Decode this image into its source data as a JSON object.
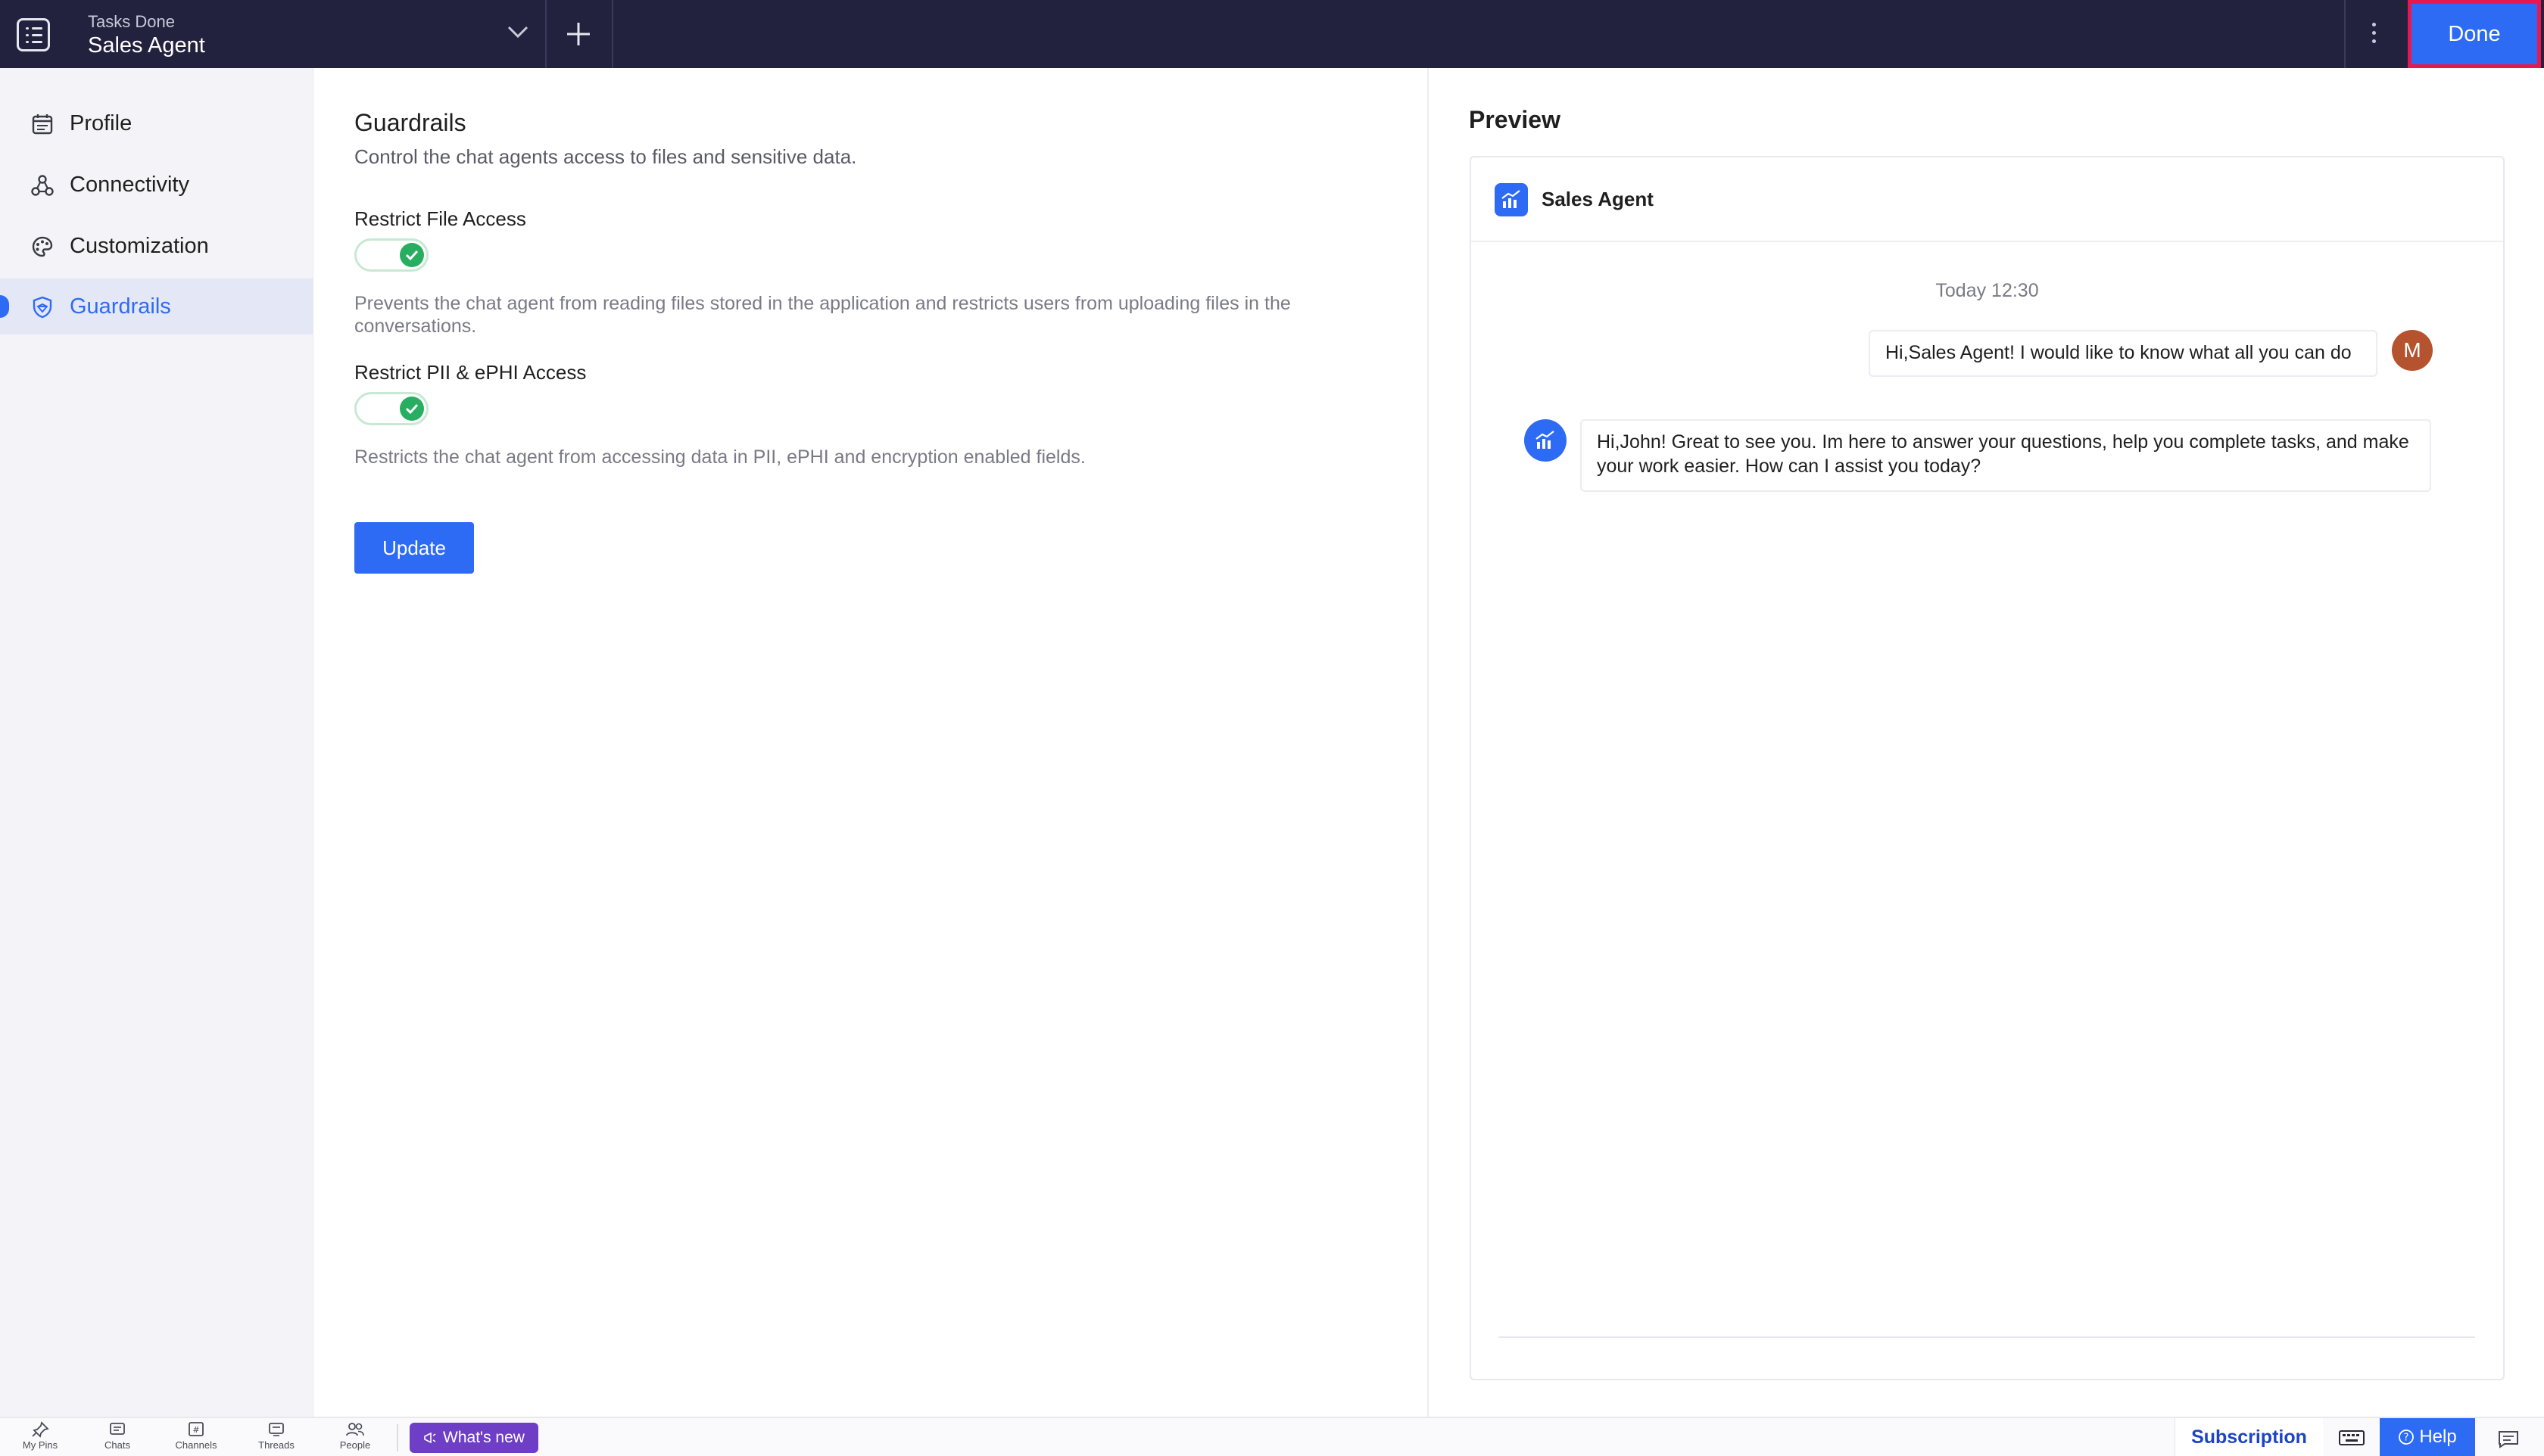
{
  "topbar": {
    "subtitle": "Tasks Done",
    "title": "Sales Agent",
    "done_label": "Done"
  },
  "sidebar": {
    "items": [
      {
        "label": "Profile",
        "icon": "calendar-icon"
      },
      {
        "label": "Connectivity",
        "icon": "network-icon"
      },
      {
        "label": "Customization",
        "icon": "palette-icon"
      },
      {
        "label": "Guardrails",
        "icon": "shield-icon",
        "active": true
      }
    ]
  },
  "guardrails": {
    "title": "Guardrails",
    "subtitle": "Control the chat agents access to files and sensitive data.",
    "options": [
      {
        "title": "Restrict File Access",
        "enabled": true,
        "description": "Prevents the chat agent from reading files stored in the application and restricts users from uploading files in the conversations."
      },
      {
        "title": "Restrict PII & ePHI Access",
        "enabled": true,
        "description": "Restricts the chat agent from accessing data in PII, ePHI and encryption enabled fields."
      }
    ],
    "update_label": "Update"
  },
  "preview": {
    "heading": "Preview",
    "agent_name": "Sales Agent",
    "timestamp": "Today 12:30",
    "user_initial": "M",
    "user_message": "Hi,Sales Agent! I would like to know what all you can do",
    "bot_message": "Hi,John! Great to see you. Im here to answer your questions, help you complete tasks, and make your work easier. How can I assist you today?"
  },
  "bottombar": {
    "items": [
      {
        "label": "My Pins",
        "icon": "pin-icon"
      },
      {
        "label": "Chats",
        "icon": "chat-icon"
      },
      {
        "label": "Channels",
        "icon": "channels-icon"
      },
      {
        "label": "Threads",
        "icon": "threads-icon"
      },
      {
        "label": "People",
        "icon": "people-icon"
      }
    ],
    "whats_new": "What's new",
    "subscription": "Subscription",
    "help": "Help"
  },
  "colors": {
    "topbar": "#22223f",
    "accent": "#2e6bf5",
    "done_highlight": "#e8174f",
    "toggle_on": "#27ae60",
    "whats_new": "#6f3ec7",
    "avatar": "#b5532e"
  }
}
